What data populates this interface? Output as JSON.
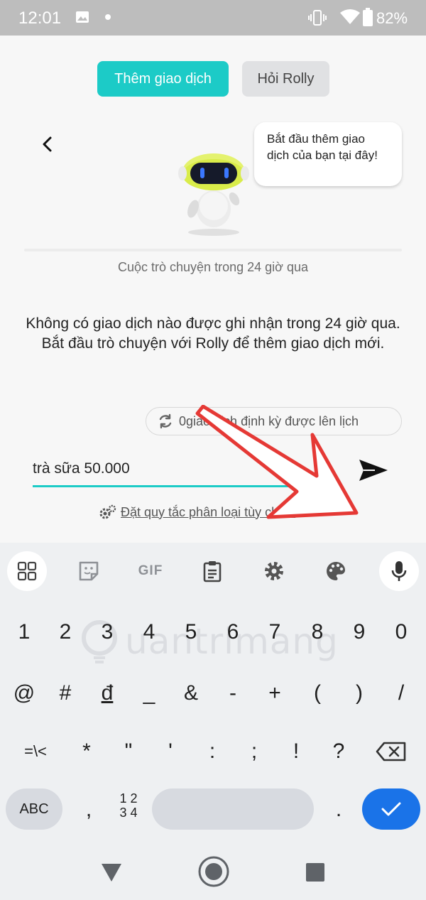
{
  "status_bar": {
    "time": "12:01",
    "battery": "82%"
  },
  "header": {
    "tabs": [
      {
        "label": "Thêm giao dịch",
        "active": true
      },
      {
        "label": "Hỏi Rolly",
        "active": false
      }
    ]
  },
  "assistant": {
    "bubble_text": "Bắt đầu thêm giao dịch của bạn tại đây!"
  },
  "conversation": {
    "caption": "Cuộc trò chuyện trong 24 giờ qua",
    "empty_line1": "Không có giao dịch nào được ghi nhận trong 24 giờ qua.",
    "empty_line2": "Bắt đầu trò chuyện với Rolly để thêm giao dịch mới."
  },
  "recurring": {
    "label": "0giao dịch định kỳ được lên lịch"
  },
  "composer": {
    "value": "trà sữa 50.000",
    "rule_link": "Đặt quy tắc phân loại tùy chỉnh"
  },
  "keyboard": {
    "toolbar": {
      "gif_label": "GIF"
    },
    "row1": [
      "1",
      "2",
      "3",
      "4",
      "5",
      "6",
      "7",
      "8",
      "9",
      "0"
    ],
    "row2": [
      "@",
      "#",
      "đ",
      "_",
      "&",
      "-",
      "+",
      "(",
      ")",
      "/"
    ],
    "row3": [
      "=\\<",
      "*",
      "\"",
      "'",
      ":",
      ";",
      "!",
      "?"
    ],
    "abc_label": "ABC",
    "comma": ",",
    "num_label_top": "1 2",
    "num_label_bottom": "3 4",
    "period": "."
  },
  "watermark": "uantrimang",
  "colors": {
    "accent": "#1ccbc7",
    "enter_key": "#1a73e8",
    "annotation_arrow": "#e53935"
  }
}
